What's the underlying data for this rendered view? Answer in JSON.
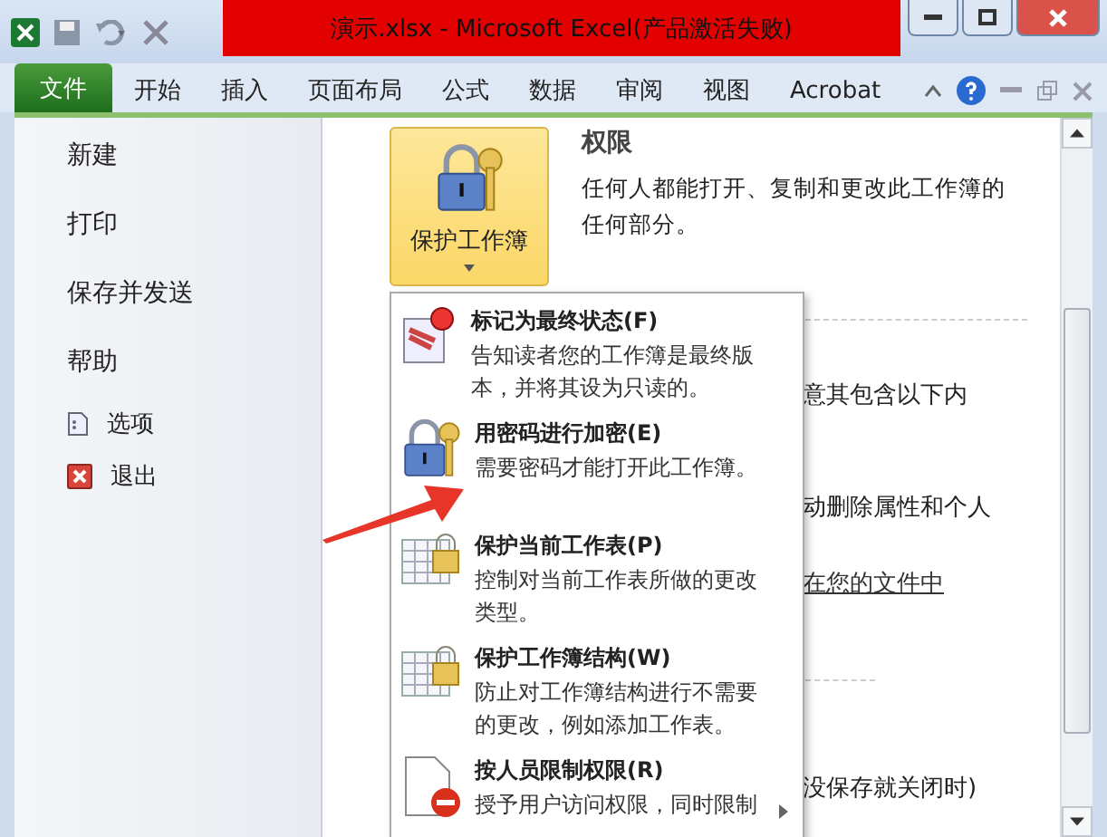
{
  "window": {
    "title": "演示.xlsx  -  Microsoft Excel(产品激活失败)"
  },
  "ribbon_tabs": [
    {
      "label": "文件",
      "selected": true
    },
    {
      "label": "开始",
      "selected": false
    },
    {
      "label": "插入",
      "selected": false
    },
    {
      "label": "页面布局",
      "selected": false
    },
    {
      "label": "公式",
      "selected": false
    },
    {
      "label": "数据",
      "selected": false
    },
    {
      "label": "审阅",
      "selected": false
    },
    {
      "label": "视图",
      "selected": false
    },
    {
      "label": "Acrobat",
      "selected": false
    }
  ],
  "sidebar": {
    "items": [
      {
        "label": "新建",
        "kind": "text"
      },
      {
        "label": "打印",
        "kind": "text"
      },
      {
        "label": "保存并发送",
        "kind": "text"
      },
      {
        "label": "帮助",
        "kind": "text"
      },
      {
        "label": "选项",
        "kind": "options"
      },
      {
        "label": "退出",
        "kind": "exit"
      }
    ]
  },
  "permissions": {
    "button_label": "保护工作簿",
    "title": "权限",
    "description": "任何人都能打开、复制和更改此工作簿的任何部分。"
  },
  "background_lines": [
    {
      "text": "意其包含以下内",
      "kind": "text"
    },
    {
      "text": "动删除属性和个人",
      "kind": "text"
    },
    {
      "text": "在您的文件中",
      "kind": "link"
    },
    {
      "text": "没保存就关闭时)",
      "kind": "text"
    }
  ],
  "protect_menu": [
    {
      "title": "标记为最终状态(F)",
      "description": "告知读者您的工作簿是最终版本，并将其设为只读的。",
      "kind": "final",
      "submenu": false
    },
    {
      "title": "用密码进行加密(E)",
      "description": "需要密码才能打开此工作簿。",
      "kind": "encrypt",
      "submenu": false
    },
    {
      "title": "保护当前工作表(P)",
      "description": "控制对当前工作表所做的更改类型。",
      "kind": "sheet",
      "submenu": false
    },
    {
      "title": "保护工作簿结构(W)",
      "description": "防止对工作簿结构进行不需要的更改，例如添加工作表。",
      "kind": "sheet",
      "submenu": false
    },
    {
      "title": "按人员限制权限(R)",
      "description": "授予用户访问权限，同时限制",
      "kind": "restrict",
      "submenu": true
    }
  ]
}
